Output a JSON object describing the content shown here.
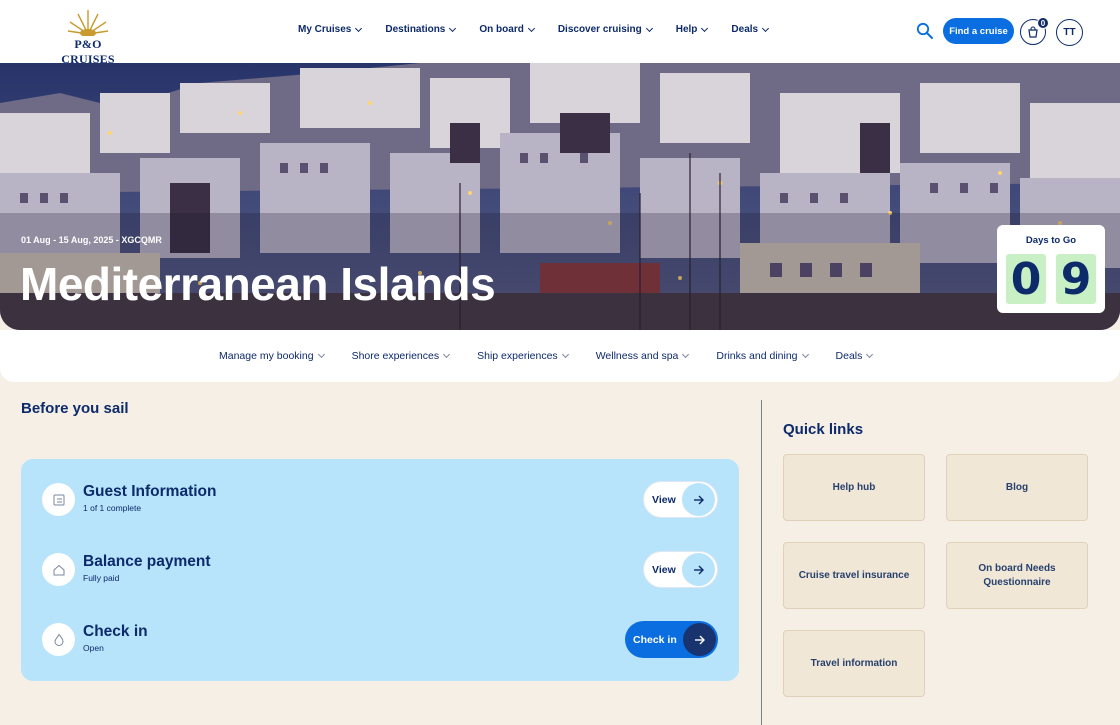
{
  "header": {
    "logo_text": "P&O CRUISES",
    "nav": [
      "My Cruises",
      "Destinations",
      "On board",
      "Discover cruising",
      "Help",
      "Deals"
    ],
    "find_cruise": "Find a cruise",
    "cart_count": "0",
    "avatar_initials": "TT",
    "accent_color": "#0a6ee0"
  },
  "hero": {
    "date_line": "01 Aug - 15 Aug, 2025 - XGCQMR",
    "title": "Mediterranean Islands",
    "countdown_label": "Days to Go",
    "digit1": "0",
    "digit2": "9"
  },
  "subnav": [
    "Manage my booking",
    "Shore experiences",
    "Ship experiences",
    "Wellness and spa",
    "Drinks and dining",
    "Deals"
  ],
  "before": {
    "title": "Before you sail",
    "tasks": [
      {
        "title": "Guest Information",
        "sub": "1 of 1 complete",
        "action": "View",
        "icon": "clipboard-icon"
      },
      {
        "title": "Balance payment",
        "sub": "Fully paid",
        "action": "View",
        "icon": "home-icon"
      },
      {
        "title": "Check in",
        "sub": "Open",
        "action": "Check in",
        "icon": "flame-icon"
      }
    ]
  },
  "quick_links": {
    "title": "Quick links",
    "items": [
      "Help hub",
      "Blog",
      "Cruise travel insurance",
      "On board Needs Questionnaire",
      "Travel information"
    ]
  }
}
